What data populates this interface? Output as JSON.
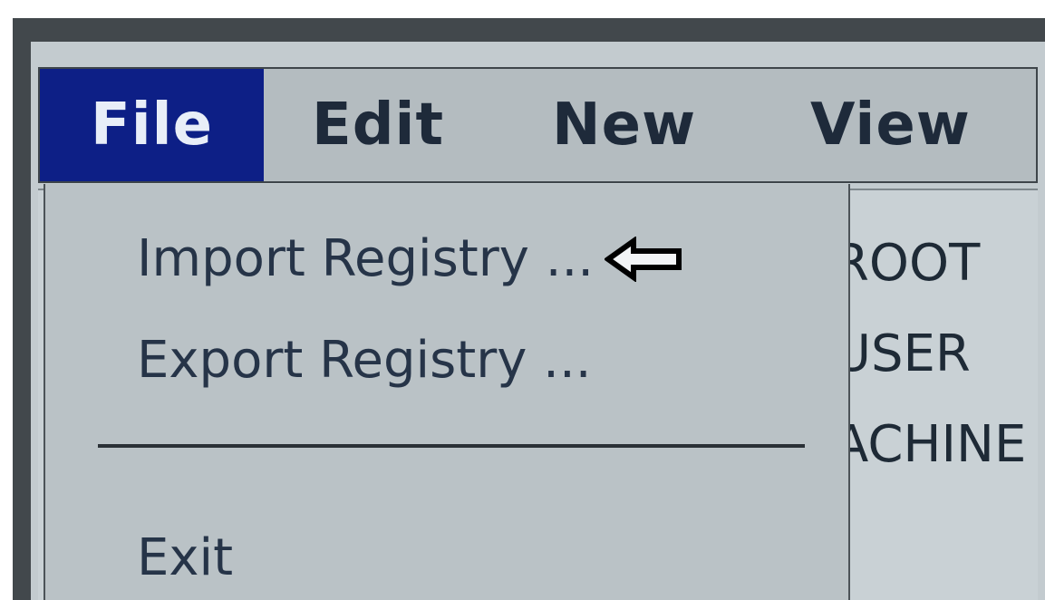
{
  "menubar": {
    "file": "File",
    "edit": "Edit",
    "new": "New",
    "view": "View"
  },
  "file_menu": {
    "import": "Import Registry ...",
    "export": "Export Registry ...",
    "exit": "Exit"
  },
  "tree": {
    "root": "ROOT",
    "user": "USER",
    "machine": "ACHINE"
  },
  "colors": {
    "menu_active_bg": "#0d1f86",
    "menu_bg": "#b4bcc0",
    "dropdown_bg": "#bac2c6"
  },
  "icons": {
    "pointer": "left-arrow-outline-icon"
  }
}
